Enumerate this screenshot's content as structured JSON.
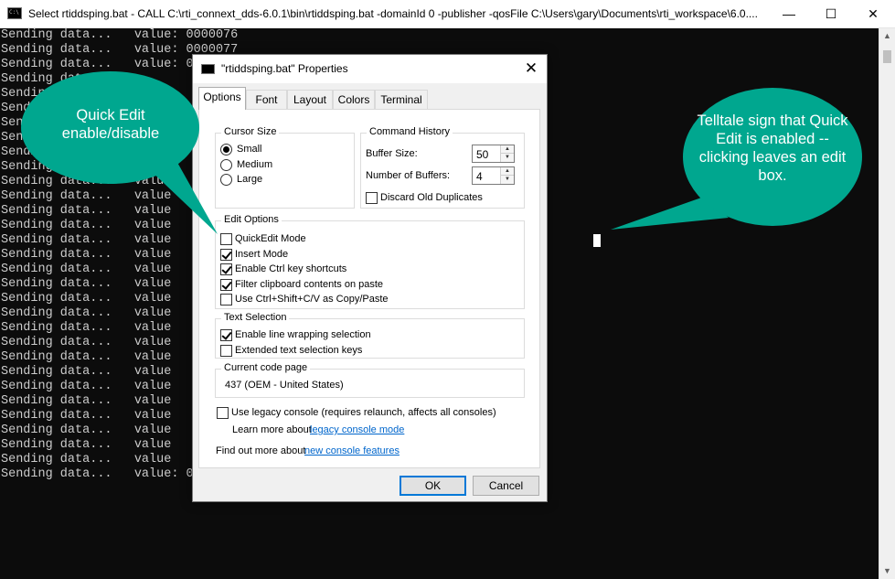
{
  "console": {
    "title": "Select rtiddsping.bat - CALL   C:\\rti_connext_dds-6.0.1\\bin\\rtiddsping.bat -domainId 0 -publisher -qosFile C:\\Users\\gary\\Documents\\rti_workspace\\6.0....",
    "window_controls": {
      "minimize": "—",
      "maximize": "☐",
      "close": "✕"
    },
    "scroll_up": "▲",
    "scroll_down": "▼",
    "lines": [
      "Sending data...   value: 0000076",
      "Sending data...   value: 0000077",
      "Sending data...   value: 0",
      "Sending data...",
      "Sending data...",
      "Sending data...",
      "Sending data...",
      "Sending data...",
      "Sending data...",
      "Sending data...   value",
      "Sending data...   value",
      "Sending data...   value",
      "Sending data...   value",
      "Sending data...   value",
      "Sending data...   value",
      "Sending data...   value",
      "Sending data...   value",
      "Sending data...   value",
      "Sending data...   value",
      "Sending data...   value",
      "Sending data...   value",
      "Sending data...   value",
      "Sending data...   value",
      "Sending data...   value",
      "Sending data...   value",
      "Sending data...   value",
      "Sending data...   value",
      "Sending data...   value",
      "Sending data...   value",
      "Sending data...   value",
      "Sending data...   value: 0"
    ]
  },
  "dialog": {
    "title": "\"rtiddsping.bat\" Properties",
    "close": "✕",
    "tabs": [
      "Options",
      "Font",
      "Layout",
      "Colors",
      "Terminal"
    ],
    "cursor_size": {
      "label": "Cursor Size",
      "options": [
        "Small",
        "Medium",
        "Large"
      ],
      "selected": "Small"
    },
    "command_history": {
      "label": "Command History",
      "buffer_size_label": "Buffer Size:",
      "buffer_size": "50",
      "num_buffers_label": "Number of Buffers:",
      "num_buffers": "4",
      "discard_label": "Discard Old Duplicates"
    },
    "edit_options": {
      "label": "Edit Options",
      "items": [
        {
          "label": "QuickEdit Mode",
          "checked": false
        },
        {
          "label": "Insert Mode",
          "checked": true
        },
        {
          "label": "Enable Ctrl key shortcuts",
          "checked": true
        },
        {
          "label": "Filter clipboard contents on paste",
          "checked": true
        },
        {
          "label": "Use Ctrl+Shift+C/V as Copy/Paste",
          "checked": false
        }
      ]
    },
    "text_selection": {
      "label": "Text Selection",
      "items": [
        {
          "label": "Enable line wrapping selection",
          "checked": true
        },
        {
          "label": "Extended text selection keys",
          "checked": false
        }
      ]
    },
    "code_page": {
      "label": "Current code page",
      "value": "437   (OEM - United States)"
    },
    "legacy": {
      "label": "Use legacy console (requires relaunch, affects all consoles)",
      "learn_more": "Learn more about",
      "learn_more_link": "legacy console mode"
    },
    "find_out_more": "Find out more about",
    "find_out_more_link": "new console features",
    "ok": "OK",
    "cancel": "Cancel"
  },
  "callouts": {
    "left": "Quick Edit enable/disable",
    "right": "Telltale sign that Quick Edit is enabled -- clicking leaves an edit box."
  },
  "colors": {
    "callout": "#00a78f",
    "console_bg": "#0c0c0c",
    "console_text": "#cccccc",
    "link": "#0066cc",
    "accent": "#0078d7"
  }
}
